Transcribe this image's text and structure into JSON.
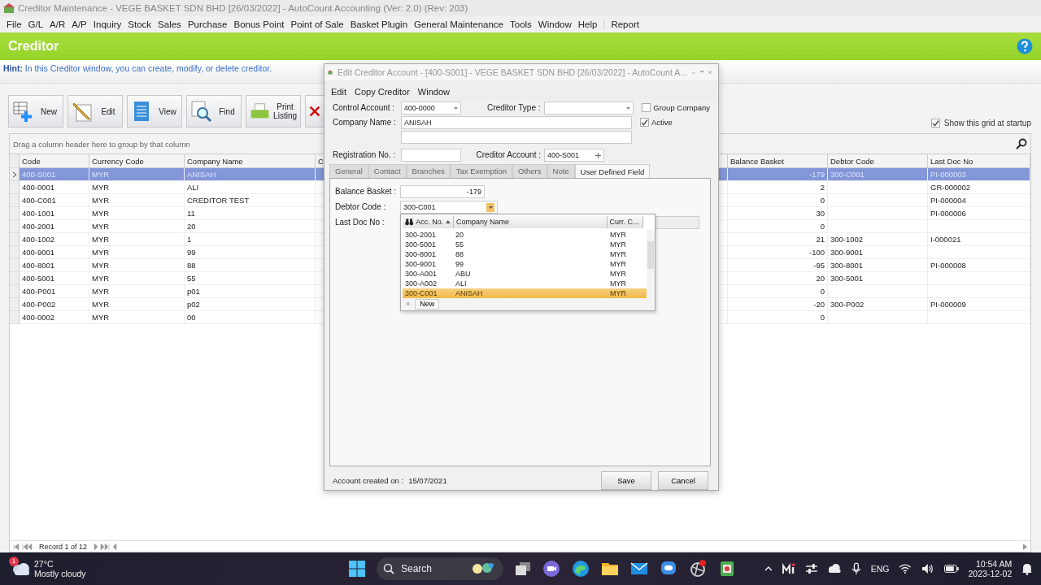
{
  "app_window": {
    "title": "Creditor Maintenance - VEGE BASKET SDN BHD [26/03/2022] - AutoCount Accounting (Ver: 2.0) (Rev: 203)",
    "menu": [
      "File",
      "G/L",
      "A/R",
      "A/P",
      "Inquiry",
      "Stock",
      "Sales",
      "Purchase",
      "Bonus Point",
      "Point of Sale",
      "Basket Plugin",
      "General Maintenance",
      "Tools",
      "Window",
      "Help",
      "Report"
    ]
  },
  "header": {
    "title": "Creditor"
  },
  "hint": {
    "label": "Hint:",
    "text": "In this Creditor window, you can create, modify, or delete creditor."
  },
  "toolbar": [
    {
      "kind": "new",
      "label": "New"
    },
    {
      "kind": "edit",
      "label": "Edit"
    },
    {
      "kind": "view",
      "label": "View"
    },
    {
      "kind": "find",
      "label": "Find"
    },
    {
      "kind": "print",
      "label": "Print Listing"
    },
    {
      "kind": "delete"
    }
  ],
  "show_grid_at_startup": {
    "label": "Show this grid at startup",
    "checked": true
  },
  "grid": {
    "group_hint": "Drag a column header here to group by that column",
    "columns": [
      "Code",
      "Currency Code",
      "Company Name",
      "C",
      "Balance Basket",
      "Debtor Code",
      "Last Doc No"
    ],
    "rows": [
      {
        "selected": true,
        "code": "400-S001",
        "currency": "MYR",
        "company": "ANISAH",
        "balance": "-179",
        "debtor": "300-C001",
        "last_doc": "PI-000003"
      },
      {
        "selected": false,
        "code": "400-0001",
        "currency": "MYR",
        "company": "ALI",
        "balance": "2",
        "last_doc": "GR-000002"
      },
      {
        "selected": false,
        "code": "400-C001",
        "currency": "MYR",
        "company": "CREDITOR TEST",
        "balance": "0",
        "last_doc": "PI-000004"
      },
      {
        "selected": false,
        "code": "400-1001",
        "currency": "MYR",
        "company": "11",
        "balance": "30",
        "last_doc": "PI-000006"
      },
      {
        "selected": false,
        "code": "400-2001",
        "currency": "MYR",
        "company": "20",
        "balance": "0"
      },
      {
        "selected": false,
        "code": "400-1002",
        "currency": "MYR",
        "company": "1",
        "balance": "21",
        "debtor": "300-1002",
        "last_doc": "I-000021"
      },
      {
        "selected": false,
        "code": "400-9001",
        "currency": "MYR",
        "company": "99",
        "balance": "-100",
        "debtor": "300-9001"
      },
      {
        "selected": false,
        "code": "400-8001",
        "currency": "MYR",
        "company": "88",
        "balance": "-95",
        "debtor": "300-8001",
        "last_doc": "PI-000008"
      },
      {
        "selected": false,
        "code": "400-5001",
        "currency": "MYR",
        "company": "55",
        "balance": "20",
        "debtor": "300-5001"
      },
      {
        "selected": false,
        "code": "400-P001",
        "currency": "MYR",
        "company": "p01",
        "balance": "0"
      },
      {
        "selected": false,
        "code": "400-P002",
        "currency": "MYR",
        "company": "p02",
        "balance": "-20",
        "debtor": "300-P002",
        "last_doc": "PI-000009"
      },
      {
        "selected": false,
        "code": "400-0002",
        "currency": "MYR",
        "company": "00",
        "balance": "0"
      }
    ]
  },
  "navigator": {
    "record": "Record 1 of 12"
  },
  "dialog": {
    "title": "Edit Creditor Account - [400-S001] - VEGE BASKET SDN BHD [26/03/2022] - AutoCount A...",
    "menu": [
      "Edit",
      "Copy Creditor",
      "Window"
    ],
    "control_account": {
      "label": "Control Account :",
      "value": "400-0000"
    },
    "creditor_type": {
      "label": "Creditor Type :"
    },
    "group_company": {
      "label": "Group Company",
      "checked": false
    },
    "active": {
      "label": "Active",
      "checked": true
    },
    "company_name": {
      "label": "Company Name :",
      "value": "ANISAH"
    },
    "registration_no": {
      "label": "Registration No. :"
    },
    "creditor_account": {
      "label": "Creditor Account :",
      "value": "400-S001"
    },
    "tabs": [
      {
        "label": "General",
        "selected": false
      },
      {
        "label": "Contact",
        "selected": false
      },
      {
        "label": "Branches",
        "selected": false
      },
      {
        "label": "Tax Exemption",
        "selected": false
      },
      {
        "label": "Others",
        "selected": false
      },
      {
        "label": "Note",
        "selected": false
      },
      {
        "label": "User Defined Field",
        "selected": true
      }
    ],
    "balance_basket": {
      "label": "Balance Basket :",
      "value": "-179"
    },
    "debtor_code": {
      "label": "Debtor Code :",
      "value": "300-C001"
    },
    "last_doc_no": {
      "label": "Last Doc No :"
    },
    "lookup": {
      "columns": [
        "Acc. No.",
        "Company Name",
        "Curr. C..."
      ],
      "rows": [
        {
          "selected": false,
          "acc": "300-2001",
          "name": "20",
          "curr": "MYR"
        },
        {
          "selected": false,
          "acc": "300-5001",
          "name": "55",
          "curr": "MYR"
        },
        {
          "selected": false,
          "acc": "300-8001",
          "name": "88",
          "curr": "MYR"
        },
        {
          "selected": false,
          "acc": "300-9001",
          "name": "99",
          "curr": "MYR"
        },
        {
          "selected": false,
          "acc": "300-A001",
          "name": "ABU",
          "curr": "MYR"
        },
        {
          "selected": false,
          "acc": "300-A002",
          "name": "ALI",
          "curr": "MYR"
        },
        {
          "selected": true,
          "acc": "300-C001",
          "name": "ANISAH",
          "curr": "MYR"
        }
      ],
      "clear": "×",
      "new_button": "New"
    },
    "account_created": {
      "label": "Account created on :",
      "value": "15/07/2021"
    },
    "buttons": [
      "Save",
      "Cancel"
    ]
  },
  "taskbar": {
    "weather_badge": "1",
    "temperature": "27°C",
    "condition": "Mostly cloudy",
    "search": "Search",
    "language": "ENG",
    "time": "10:54 AM",
    "date": "2023-12-02"
  }
}
